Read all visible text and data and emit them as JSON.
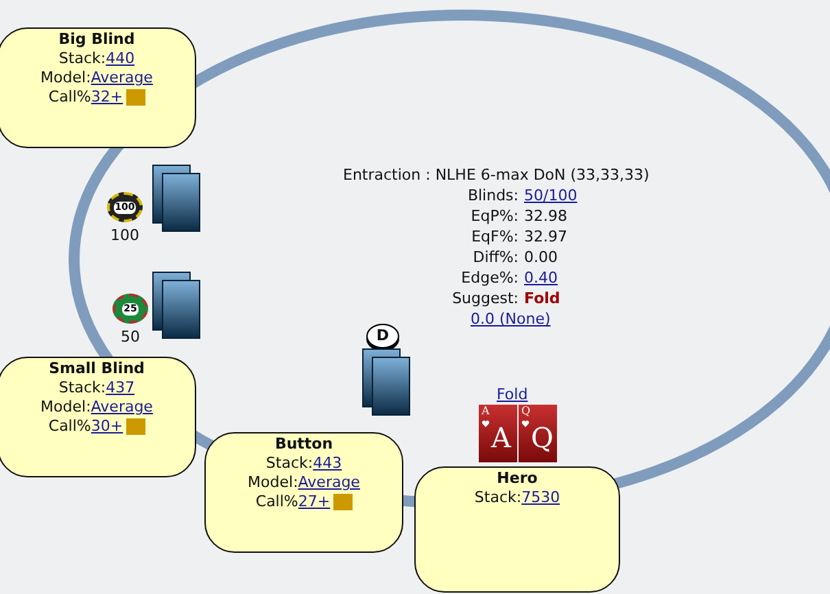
{
  "seats": [
    {
      "name": "Big Blind",
      "fields": [
        {
          "label": "Stack:",
          "value": "440",
          "kind": "plain"
        },
        {
          "label": "Model:",
          "value": "Average",
          "kind": "plain"
        },
        {
          "label": "Call%",
          "value": "32+",
          "kind": "swatch"
        }
      ]
    },
    {
      "name": "Small Blind",
      "fields": [
        {
          "label": "Stack:",
          "value": "437",
          "kind": "plain"
        },
        {
          "label": "Model:",
          "value": "Average",
          "kind": "plain"
        },
        {
          "label": "Call%",
          "value": "30+",
          "kind": "swatch"
        }
      ]
    },
    {
      "name": "Button",
      "fields": [
        {
          "label": "Stack:",
          "value": "443",
          "kind": "plain"
        },
        {
          "label": "Model:",
          "value": "Average",
          "kind": "plain"
        },
        {
          "label": "Call%",
          "value": "27+",
          "kind": "swatch"
        }
      ]
    },
    {
      "name": "Hero",
      "fields": [
        {
          "label": "Stack:",
          "value": "7530",
          "kind": "plain"
        }
      ]
    }
  ],
  "bets": [
    {
      "chip": "100",
      "amount": "100"
    },
    {
      "chip": "25",
      "amount": "50"
    }
  ],
  "dealer_button": "D",
  "hero_action": "Fold",
  "hero_cards": [
    {
      "corner": "A",
      "rank": "A"
    },
    {
      "corner": "Q",
      "rank": "Q"
    }
  ],
  "info": {
    "title": "Entraction : NLHE 6-max DoN (33,33,33)",
    "rows": [
      {
        "label": "Blinds:",
        "value": "50/100",
        "kind": "link"
      },
      {
        "label": "EqP%:",
        "value": "32.98",
        "kind": "plain"
      },
      {
        "label": "EqF%:",
        "value": "32.97",
        "kind": "plain"
      },
      {
        "label": "Diff%:",
        "value": "0.00",
        "kind": "plain"
      },
      {
        "label": "Edge%:",
        "value": "0.40",
        "kind": "link"
      },
      {
        "label": "Suggest:",
        "value": "Fold",
        "kind": "action"
      }
    ],
    "footer": "0.0 (None)"
  }
}
